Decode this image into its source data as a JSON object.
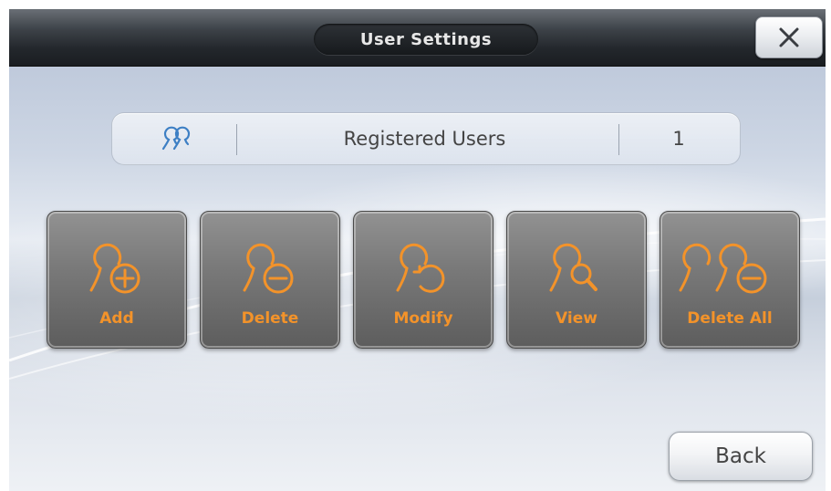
{
  "window": {
    "title": "User Settings"
  },
  "info": {
    "label": "Registered Users",
    "count": "1",
    "icon": "users-icon"
  },
  "actions": [
    {
      "label": "Add",
      "icon": "user-add-icon"
    },
    {
      "label": "Delete",
      "icon": "user-delete-icon"
    },
    {
      "label": "Modify",
      "icon": "user-modify-icon"
    },
    {
      "label": "View",
      "icon": "user-view-icon"
    },
    {
      "label": "Delete All",
      "icon": "users-delete-all-icon"
    }
  ],
  "footer": {
    "back_label": "Back"
  },
  "colors": {
    "accent": "#f3932a",
    "title_text": "#e8e8e8",
    "button_bg": "#7a7a7a",
    "info_icon": "#3d7fc4"
  }
}
